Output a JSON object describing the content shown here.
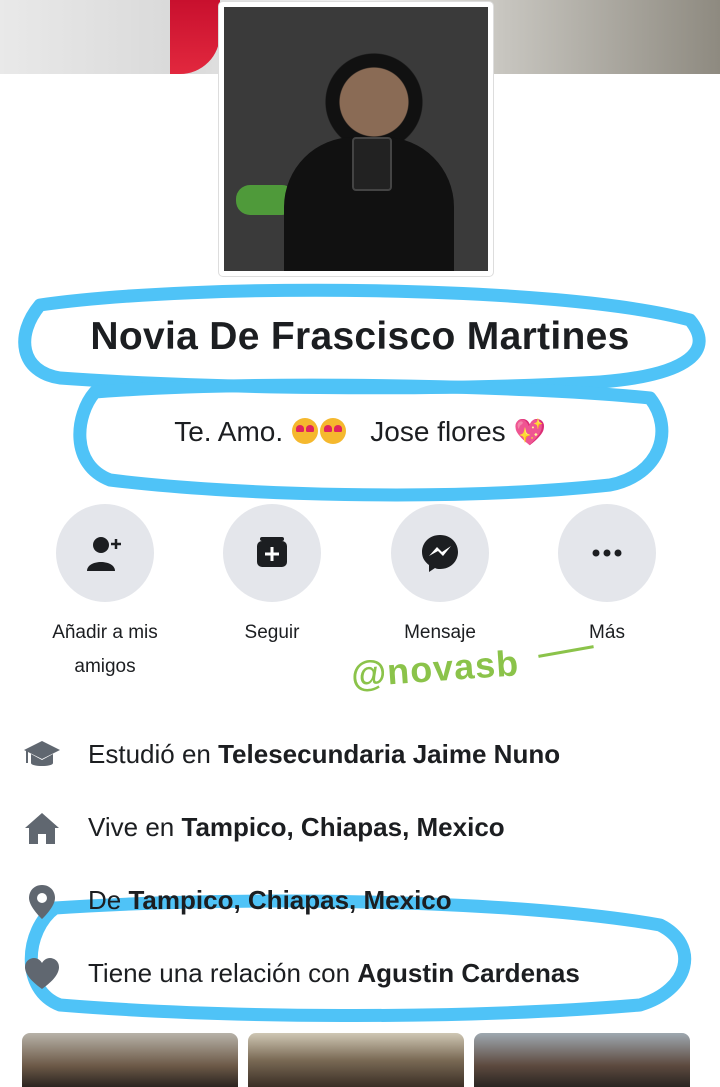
{
  "profile": {
    "name": "Novia De Frascisco Martines",
    "bio_prefix": "Te. Amo.",
    "bio_suffix": "Jose flores"
  },
  "actions": [
    {
      "label": "Añadir a mis amigos",
      "icon": "add-friend-icon"
    },
    {
      "label": "Seguir",
      "icon": "follow-icon"
    },
    {
      "label": "Mensaje",
      "icon": "messenger-icon"
    },
    {
      "label": "Más",
      "icon": "more-icon"
    }
  ],
  "watermark": "@novasb",
  "info": {
    "studied": {
      "prefix": "Estudió en",
      "value": "Telesecundaria Jaime Nuno",
      "icon": "graduation-cap-icon"
    },
    "lives": {
      "prefix": "Vive en",
      "value": "Tampico, Chiapas, Mexico",
      "icon": "home-icon"
    },
    "from": {
      "prefix": "De",
      "value": "Tampico, Chiapas, Mexico",
      "icon": "location-pin-icon"
    },
    "relationship": {
      "prefix": "Tiene una relación con",
      "value": "Agustin Cardenas",
      "icon": "heart-icon"
    }
  },
  "colors": {
    "highlight": "#4fc3f7",
    "button_bg": "#e4e6eb",
    "watermark": "#8bc34a",
    "icon": "#606770"
  }
}
